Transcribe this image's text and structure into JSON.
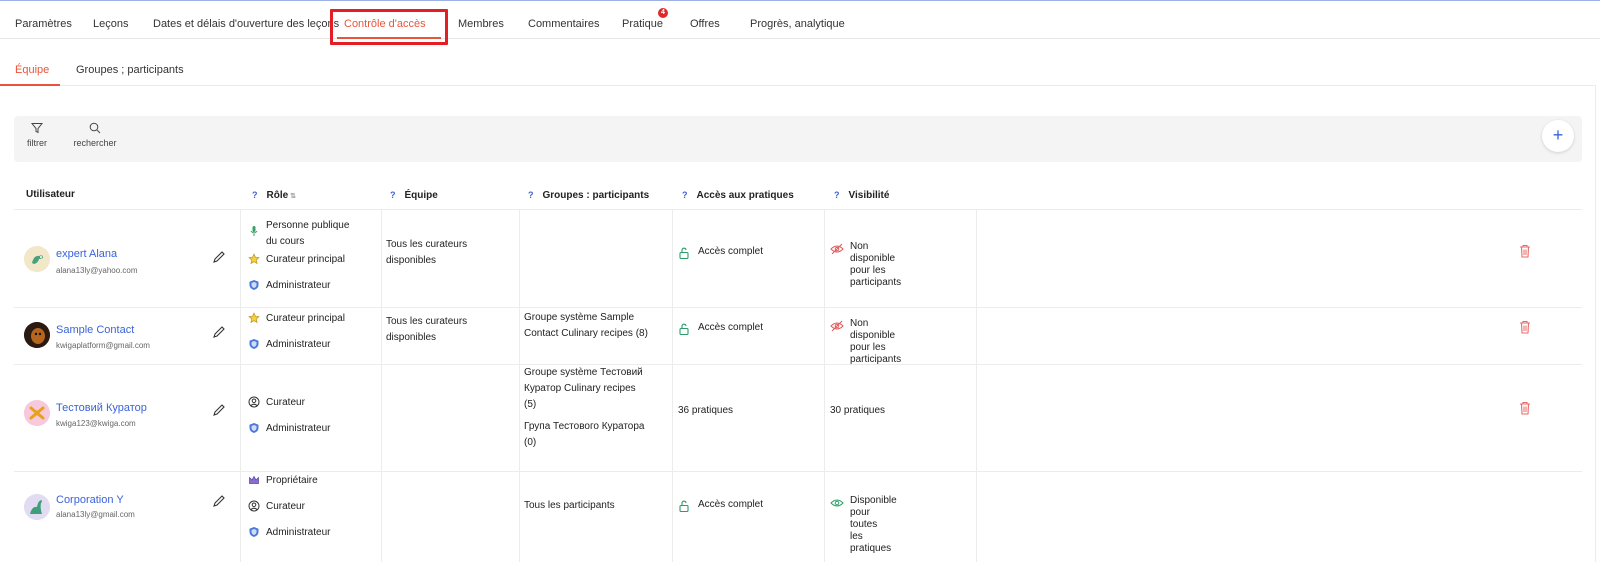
{
  "main_tabs": [
    {
      "label": "Paramètres"
    },
    {
      "label": "Leçons"
    },
    {
      "label": "Dates et délais d'ouverture des leçons"
    },
    {
      "label": "Contrôle d'accès",
      "active": true
    },
    {
      "label": "Membres"
    },
    {
      "label": "Commentaires"
    },
    {
      "label": "Pratique",
      "badge": "4"
    },
    {
      "label": "Offres"
    },
    {
      "label": "Progrès, analytique"
    }
  ],
  "sub_tabs": [
    {
      "label": "Équipe",
      "active": true
    },
    {
      "label": "Groupes ; participants"
    }
  ],
  "toolbar": {
    "filter_label": "filtrer",
    "search_label": "rechercher",
    "add_label": "+"
  },
  "columns": {
    "user": "Utilisateur",
    "role": "Rôle",
    "team": "Équipe",
    "groups": "Groupes : participants",
    "practice_access": "Accès aux pratiques",
    "visibility": "Visibilité",
    "help_mark": "?"
  },
  "rows": [
    {
      "name": "expert Alana",
      "email": "alana13ly@yahoo.com",
      "roles": [
        {
          "icon": "microphone-icon",
          "label_line1": "Personne publique",
          "label_line2": "du cours"
        },
        {
          "icon": "star-icon",
          "label_line1": "Curateur principal"
        },
        {
          "icon": "shield-icon",
          "label_line1": "Administrateur"
        }
      ],
      "team_line1": "Tous les curateurs",
      "team_line2": "disponibles",
      "access": "Accès complet",
      "visibility_line1": "Non disponible pour les",
      "visibility_line2": "participants"
    },
    {
      "name": "Sample Contact",
      "email": "kwigaplatform@gmail.com",
      "roles": [
        {
          "icon": "star-icon",
          "label_line1": "Curateur principal"
        },
        {
          "icon": "shield-icon",
          "label_line1": "Administrateur"
        }
      ],
      "team_line1": "Tous les curateurs",
      "team_line2": "disponibles",
      "groups_line1": "Groupe système Sample",
      "groups_line2": "Contact Culinary recipes (8)",
      "access": "Accès complet",
      "visibility_line1": "Non disponible pour les",
      "visibility_line2": "participants"
    },
    {
      "name": "Тестовий Куратор",
      "email": "kwiga123@kwiga.com",
      "roles": [
        {
          "icon": "user-circle-icon",
          "label_line1": "Curateur"
        },
        {
          "icon": "shield-icon",
          "label_line1": "Administrateur"
        }
      ],
      "groups_a_line1": "Groupe système Тестовий",
      "groups_a_line2": "Куратор Culinary recipes",
      "groups_a_line3": "(5)",
      "groups_b_line1": "Група Тестового Куратора",
      "groups_b_line2": "(0)",
      "access": "36 pratiques",
      "visibility": "30 pratiques"
    },
    {
      "name": "Corporation Y",
      "email": "alana13ly@gmail.com",
      "roles": [
        {
          "icon": "crown-icon",
          "label_line1": "Propriétaire"
        },
        {
          "icon": "user-circle-icon",
          "label_line1": "Curateur"
        },
        {
          "icon": "shield-icon",
          "label_line1": "Administrateur"
        }
      ],
      "groups_line1": "Tous les participants",
      "access": "Accès complet",
      "visibility_line1": "Disponible pour toutes",
      "visibility_line2": "les pratiques"
    }
  ],
  "colors": {
    "accent": "#e8553a",
    "link": "#3a63d8",
    "highlight_box": "#e31e24",
    "access_green": "#2a9d6a",
    "hidden_red": "#e05a5a",
    "trash": "#e86a6a"
  }
}
